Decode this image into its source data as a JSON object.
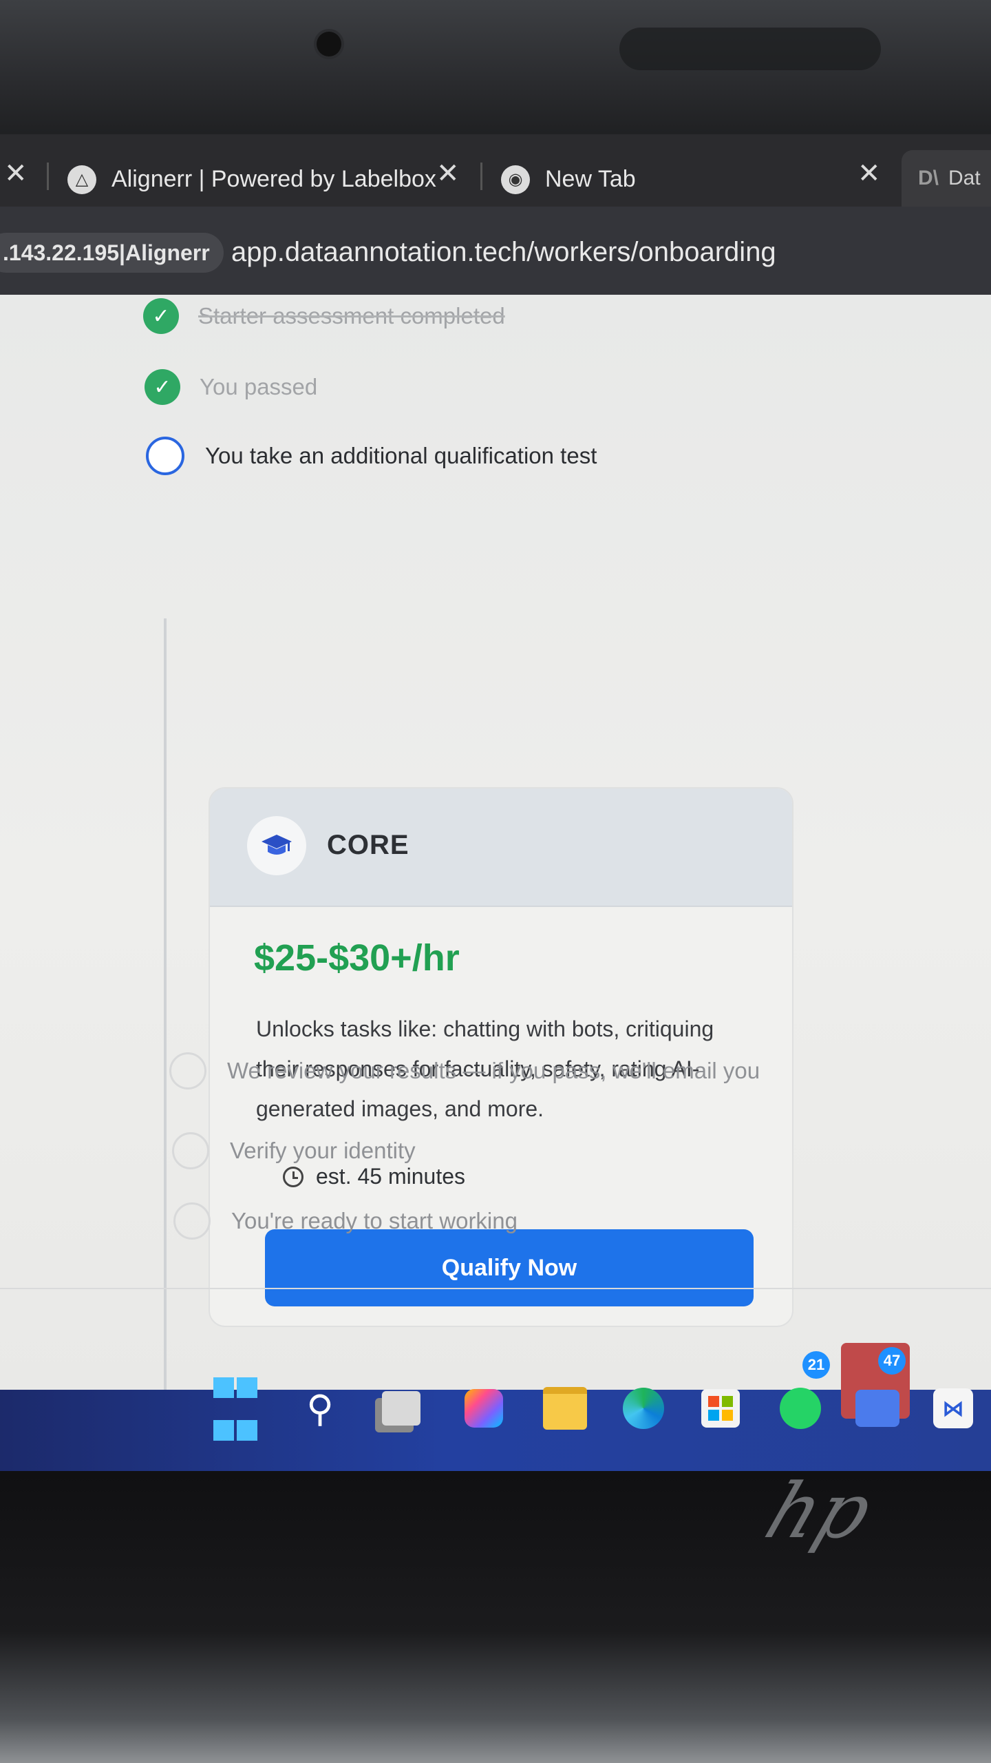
{
  "browser": {
    "tabs": [
      {
        "title": "Alignerr | Powered by Labelbox",
        "icon": "alignerr-logo-icon"
      },
      {
        "title": "New Tab",
        "icon": "chrome-icon"
      },
      {
        "title": "Dat",
        "icon": "dataannotation-icon"
      }
    ],
    "address": {
      "chip": ".143.22.195|Alignerr",
      "url": "app.dataannotation.tech/workers/onboarding"
    }
  },
  "onboarding": {
    "steps_done": [
      {
        "label": "Starter assessment completed"
      },
      {
        "label": "You passed"
      }
    ],
    "step_current": {
      "label": "You take an additional qualification test"
    },
    "card": {
      "title": "CORE",
      "rate": "$25-$30+/hr",
      "description": "Unlocks tasks like: chatting with bots, critiquing their responses for factuality, safety, rating AI-generated images, and more.",
      "estimate": "est. 45 minutes",
      "button_label": "Qualify Now"
    },
    "steps_pending": [
      {
        "label": "We review your results — if you pass, we'll email you"
      },
      {
        "label": "Verify your identity"
      },
      {
        "label": "You're ready to start working"
      }
    ]
  },
  "taskbar": {
    "icons": [
      "windows-start-icon",
      "search-icon",
      "task-view-icon",
      "copilot-icon",
      "file-explorer-icon",
      "edge-icon",
      "store-icon",
      "whatsapp-icon",
      "teams-icon",
      "app-icon"
    ],
    "badges": {
      "whatsapp": "21",
      "teams": "47"
    }
  },
  "colors": {
    "accent_blue": "#1e73ea",
    "success_green": "#21a052",
    "check_green": "#2fa864"
  }
}
